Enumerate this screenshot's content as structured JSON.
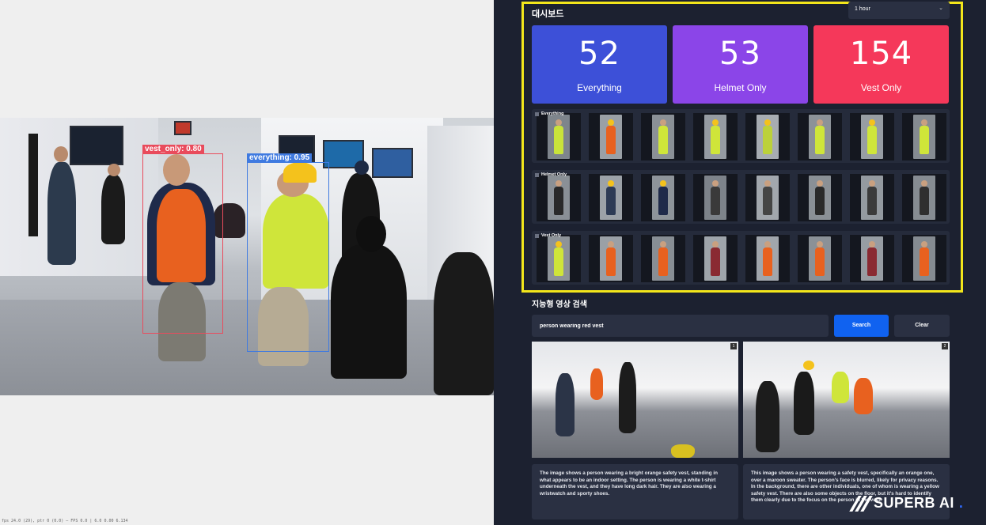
{
  "video": {
    "detections": [
      {
        "label": "vest_only: 0.80",
        "color": "#e94b5c"
      },
      {
        "label": "everything: 0.95",
        "color": "#3f7ae0"
      }
    ],
    "status_text": "fps 24.0 (29), ptr 0 (0.0) — FPS 0.0 | 6.0  0.00  6.134"
  },
  "dashboard": {
    "title": "대시보드",
    "time_range": "1 hour",
    "stats": [
      {
        "value": "52",
        "label": "Everything",
        "color": "#3d50d8"
      },
      {
        "value": "53",
        "label": "Helmet Only",
        "color": "#8b45e8"
      },
      {
        "value": "154",
        "label": "Vest Only",
        "color": "#f5385a"
      }
    ],
    "rows": [
      {
        "label": "Everything"
      },
      {
        "label": "Helmet Only"
      },
      {
        "label": "Vest Only"
      }
    ]
  },
  "search": {
    "title": "지능형 영상 검색",
    "query": "person wearing red vest",
    "search_label": "Search",
    "clear_label": "Clear",
    "results": [
      {
        "badge": "1",
        "description": "The image shows a person wearing a bright orange safety vest, standing in what appears to be an indoor setting. The person is wearing a white t-shirt underneath the vest, and they have long dark hair. They are also wearing a wristwatch and sporty shoes."
      },
      {
        "badge": "2",
        "description": "This image shows a person wearing a safety vest, specifically an orange one, over a maroon sweater. The person's face is blurred, likely for privacy reasons. In the background, there are other individuals, one of whom is wearing a yellow safety vest. There are also some objects on the floor, but it's hard to identify them clearly due to the focus on the person in the vest."
      }
    ]
  },
  "brand": {
    "name": "SUPERB AI",
    "dot": "."
  }
}
